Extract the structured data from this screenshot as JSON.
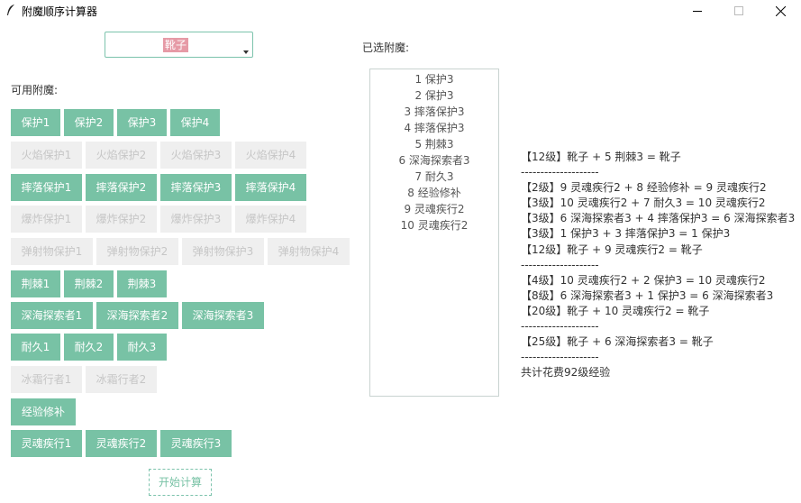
{
  "window": {
    "title": "附魔顺序计算器",
    "icon": "feather-icon"
  },
  "selector": {
    "value": "靴子"
  },
  "available_label": "可用附魔:",
  "selected_label": "已选附魔:",
  "enchants": [
    {
      "label": "保护1",
      "enabled": true
    },
    {
      "label": "保护2",
      "enabled": true
    },
    {
      "label": "保护3",
      "enabled": true
    },
    {
      "label": "保护4",
      "enabled": true
    },
    {
      "label": "火焰保护1",
      "enabled": false
    },
    {
      "label": "火焰保护2",
      "enabled": false
    },
    {
      "label": "火焰保护3",
      "enabled": false
    },
    {
      "label": "火焰保护4",
      "enabled": false
    },
    {
      "label": "摔落保护1",
      "enabled": true
    },
    {
      "label": "摔落保护2",
      "enabled": true
    },
    {
      "label": "摔落保护3",
      "enabled": true
    },
    {
      "label": "摔落保护4",
      "enabled": true
    },
    {
      "label": "爆炸保护1",
      "enabled": false
    },
    {
      "label": "爆炸保护2",
      "enabled": false
    },
    {
      "label": "爆炸保护3",
      "enabled": false
    },
    {
      "label": "爆炸保护4",
      "enabled": false
    },
    {
      "label": "弹射物保护1",
      "enabled": false
    },
    {
      "label": "弹射物保护2",
      "enabled": false
    },
    {
      "label": "弹射物保护3",
      "enabled": false
    },
    {
      "label": "弹射物保护4",
      "enabled": false
    },
    {
      "label": "荆棘1",
      "enabled": true
    },
    {
      "label": "荆棘2",
      "enabled": true
    },
    {
      "label": "荆棘3",
      "enabled": true
    },
    {
      "label": "深海探索者1",
      "enabled": true
    },
    {
      "label": "深海探索者2",
      "enabled": true
    },
    {
      "label": "深海探索者3",
      "enabled": true
    },
    {
      "label": "耐久1",
      "enabled": true
    },
    {
      "label": "耐久2",
      "enabled": true
    },
    {
      "label": "耐久3",
      "enabled": true
    },
    {
      "label": "冰霜行者1",
      "enabled": false
    },
    {
      "label": "冰霜行者2",
      "enabled": false
    },
    {
      "label": "经验修补",
      "enabled": true
    },
    {
      "label": "灵魂疾行1",
      "enabled": true
    },
    {
      "label": "灵魂疾行2",
      "enabled": true
    },
    {
      "label": "灵魂疾行3",
      "enabled": true
    }
  ],
  "start_button": "开始计算",
  "selected": [
    "1 保护3",
    "2 保护3",
    "3 摔落保护3",
    "4 摔落保护3",
    "5 荆棘3",
    "6 深海探索者3",
    "7 耐久3",
    "8 经验修补",
    "9 灵魂疾行2",
    "10 灵魂疾行2"
  ],
  "result": [
    "【12级】靴子 + 5 荆棘3 = 靴子",
    "--------------------",
    "【2级】9 灵魂疾行2 + 8 经验修补 = 9 灵魂疾行2",
    "【3级】10 灵魂疾行2 + 7 耐久3 = 10 灵魂疾行2",
    "【3级】6 深海探索者3 + 4 摔落保护3 = 6 深海探索者3",
    "【3级】1 保护3 + 3 摔落保护3 = 1 保护3",
    "【12级】靴子 + 9 灵魂疾行2 = 靴子",
    "--------------------",
    "【4级】10 灵魂疾行2 + 2 保护3 = 10 灵魂疾行2",
    "【8级】6 深海探索者3 + 1 保护3 = 6 深海探索者3",
    "【20级】靴子 + 10 灵魂疾行2 = 靴子",
    "--------------------",
    "【25级】靴子 + 6 深海探索者3 = 靴子",
    "--------------------",
    "共计花费92级经验"
  ],
  "colors": {
    "accent": "#78c2a5",
    "disabled_bg": "#efefef",
    "disabled_text": "#c6c6c6",
    "highlight": "#e69aa6"
  }
}
